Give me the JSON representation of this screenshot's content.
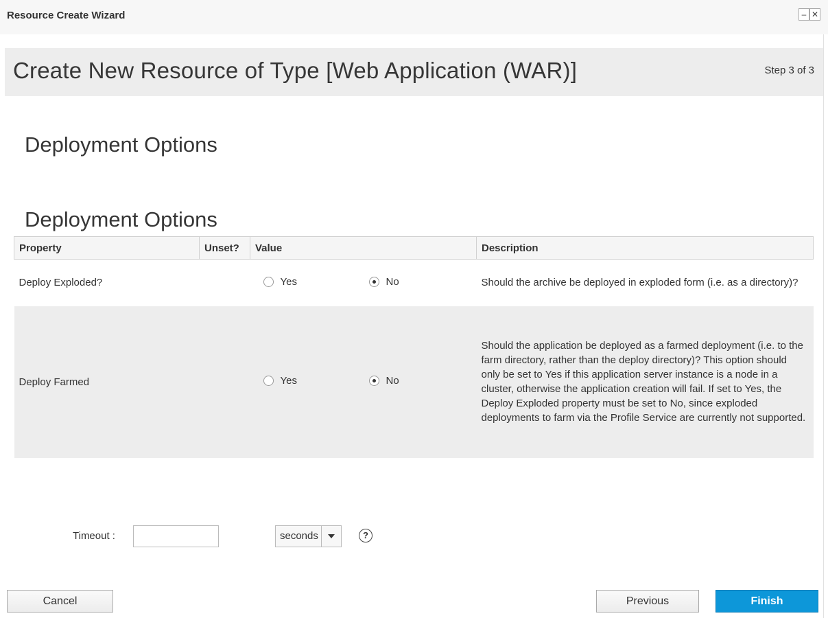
{
  "window": {
    "title": "Resource Create Wizard",
    "minimize_icon": "minimize-icon",
    "close_icon": "close-icon",
    "minimize_glyph": "–",
    "close_glyph": "✕"
  },
  "header": {
    "title": "Create New Resource of Type [Web Application (WAR)]",
    "step": "Step 3 of 3"
  },
  "section_heading": "Deployment Options",
  "table": {
    "heading": "Deployment Options",
    "columns": [
      "Property",
      "Unset?",
      "Value",
      "Description"
    ],
    "rows": [
      {
        "property": "Deploy Exploded?",
        "yes_label": "Yes",
        "no_label": "No",
        "selected": "No",
        "description": "Should the archive be deployed in exploded form (i.e. as a directory)?"
      },
      {
        "property": "Deploy Farmed",
        "yes_label": "Yes",
        "no_label": "No",
        "selected": "No",
        "description": "Should the application be deployed as a farmed deployment (i.e. to the farm directory, rather than the deploy directory)? This option should only be set to Yes if this application server instance is a node in a cluster, otherwise the application creation will fail. If set to Yes, the Deploy Exploded property must be set to No, since exploded deployments to farm via the Profile Service are currently not supported."
      }
    ]
  },
  "timeout": {
    "label": "Timeout :",
    "value": "",
    "unit": "seconds",
    "help_icon": "help-icon",
    "help_glyph": "?"
  },
  "buttons": {
    "cancel": "Cancel",
    "previous": "Previous",
    "finish": "Finish"
  },
  "colors": {
    "finish_button": "#0d97d9",
    "header_band": "#ededed"
  }
}
